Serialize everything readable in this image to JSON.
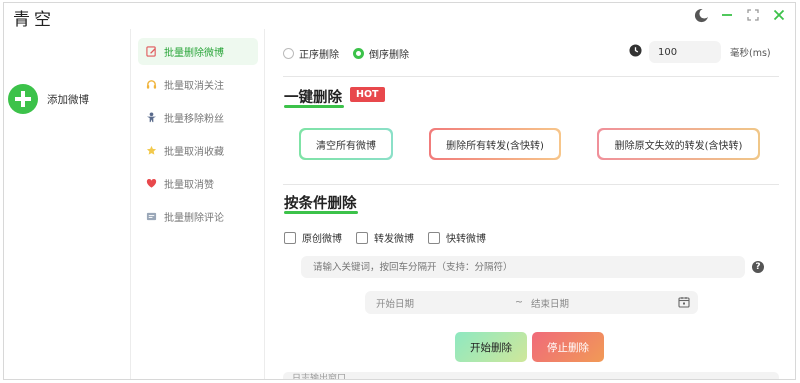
{
  "app": {
    "title": "青空"
  },
  "window_controls": {
    "theme_icon": "moon-icon",
    "minimize_icon": "minimize-icon",
    "maximize_icon": "maximize-icon",
    "close_icon": "close-icon"
  },
  "left": {
    "add_label": "添加微博"
  },
  "menu": {
    "items": [
      {
        "label": "批量删除微博",
        "icon": "edit-icon",
        "active": true
      },
      {
        "label": "批量取消关注",
        "icon": "headset-icon",
        "active": false
      },
      {
        "label": "批量移除粉丝",
        "icon": "person-icon",
        "active": false
      },
      {
        "label": "批量取消收藏",
        "icon": "star-icon",
        "active": false
      },
      {
        "label": "批量取消赞",
        "icon": "heart-icon",
        "active": false
      },
      {
        "label": "批量删除评论",
        "icon": "comment-icon",
        "active": false
      }
    ]
  },
  "order": {
    "asc_label": "正序删除",
    "desc_label": "倒序删除",
    "selected": "desc"
  },
  "delay": {
    "value": "100",
    "unit": "毫秒(ms)",
    "icon": "clock-icon"
  },
  "one_click": {
    "title": "一键删除",
    "badge": "HOT",
    "buttons": [
      "清空所有微博",
      "删除所有转发(含快转)",
      "删除原文失效的转发(含快转)"
    ]
  },
  "conditional": {
    "title": "按条件删除",
    "checkboxes": [
      "原创微博",
      "转发微博",
      "快转微博"
    ],
    "keyword_placeholder": "请输入关键词，按回车分隔开（支持：分隔符）",
    "date_start_placeholder": "开始日期",
    "date_separator": "~",
    "date_end_placeholder": "结束日期",
    "start_label": "开始删除",
    "stop_label": "停止删除"
  },
  "log": {
    "text": "日志输出窗口"
  },
  "colors": {
    "accent": "#3cc24a",
    "danger": "#e8484c"
  }
}
